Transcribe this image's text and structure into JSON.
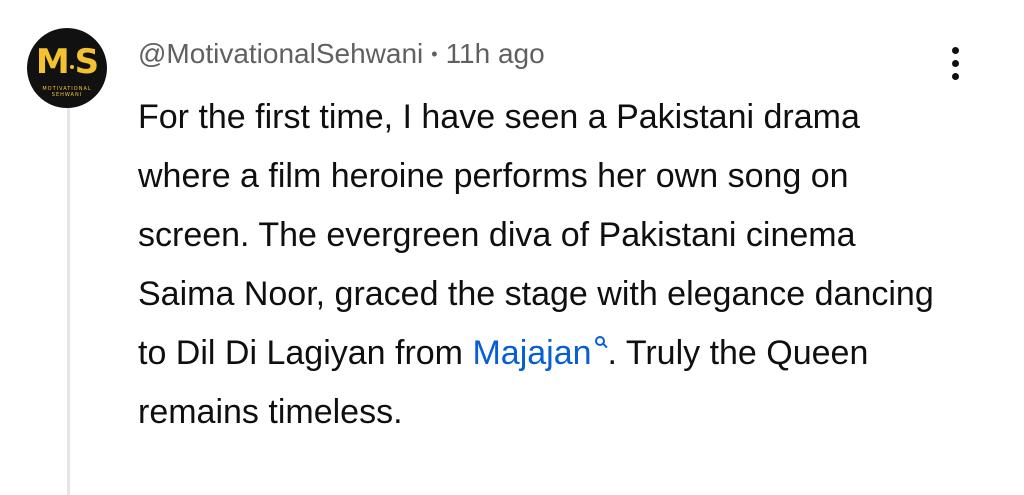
{
  "comment": {
    "avatar": {
      "logo_text_left": "M",
      "logo_text_right": "S",
      "tagline": "MOTIVATIONAL SEHWANI"
    },
    "author": "@MotivationalSehwani",
    "separator": "•",
    "timestamp": "11h ago",
    "text_before_link": "For the first time, I have seen a Pakistani drama where a film heroine performs her own song on screen. The evergreen diva of Pakistani cinema Saima Noor, graced the stage with elegance dancing to Dil Di Lagiyan from ",
    "link_text": "Majajan",
    "link_icon": "search-icon",
    "text_after_link": ". Truly the Queen remains timeless.",
    "link_color": "#065fd4",
    "menu_icon": "more-vert-icon"
  }
}
